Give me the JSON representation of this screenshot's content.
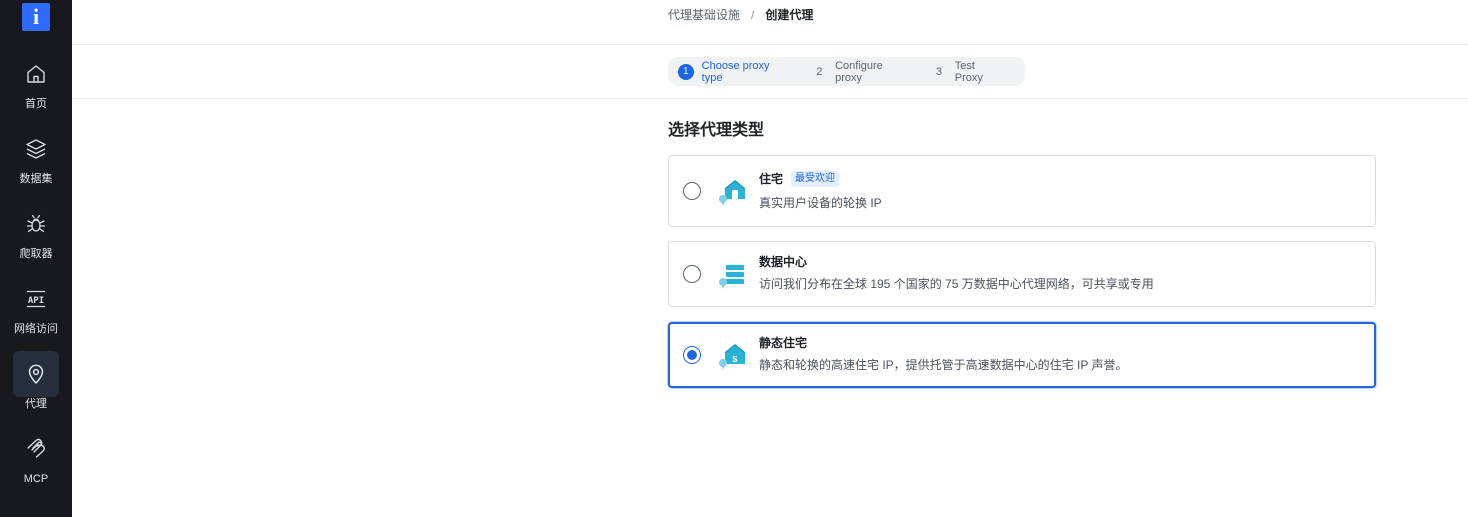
{
  "sidebar": {
    "logo_letter": "i",
    "items": [
      {
        "label": "首页",
        "icon": "home-icon",
        "active": false
      },
      {
        "label": "数据集",
        "icon": "layers-icon",
        "active": false
      },
      {
        "label": "爬取器",
        "icon": "bug-icon",
        "active": false
      },
      {
        "label": "网络访问",
        "icon": "api-icon",
        "active": false
      },
      {
        "label": "代理",
        "icon": "location-pin-icon",
        "active": true
      },
      {
        "label": "MCP",
        "icon": "mcp-icon",
        "active": false
      }
    ]
  },
  "breadcrumb": {
    "parent": "代理基础设施",
    "separator": "/",
    "current": "创建代理"
  },
  "steps": [
    {
      "number": "1",
      "label": "Choose proxy type",
      "active": true
    },
    {
      "number": "2",
      "label": "Configure proxy",
      "active": false
    },
    {
      "number": "3",
      "label": "Test Proxy",
      "active": false
    }
  ],
  "section_title": "选择代理类型",
  "options": [
    {
      "title": "住宅",
      "badge": "最受欢迎",
      "description": "真实用户设备的轮换 IP",
      "icon": "residential-house-icon",
      "selected": false
    },
    {
      "title": "数据中心",
      "badge": "",
      "description": "访问我们分布在全球 195 个国家的 75 万数据中心代理网络，可共享或专用",
      "icon": "datacenter-server-icon",
      "selected": false
    },
    {
      "title": "静态住宅",
      "badge": "",
      "description": "静态和轮换的高速住宅 IP，提供托管于高速数据中心的住宅 IP 声誉。",
      "icon": "static-residential-icon",
      "selected": true
    }
  ],
  "colors": {
    "accent": "#1a66e8",
    "sidebar_bg": "#17191c",
    "logo_bg": "#2f6bff",
    "icon_teal": "#2bb3d6"
  }
}
